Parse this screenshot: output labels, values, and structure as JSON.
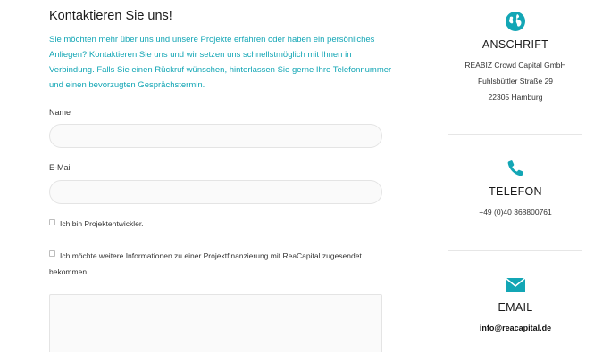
{
  "form": {
    "title": "Kontaktieren Sie uns!",
    "intro": "Sie möchten mehr über uns und unsere Projekte erfahren oder haben ein persönliches Anliegen? Kontaktieren Sie uns und wir setzen uns schnellstmöglich mit Ihnen in Verbindung. Falls Sie einen Rückruf wünschen, hinterlassen Sie gerne Ihre Telefonnummer und einen bevorzugten Gesprächstermin.",
    "name_label": "Name",
    "name_value": "",
    "email_label": "E-Mail",
    "email_value": "",
    "checkbox_developer": "Ich bin Projektentwickler.",
    "checkbox_info": "Ich möchte weitere Informationen zu einer Projektfinanzierung mit ReaCapital zugesendet bekommen.",
    "message_value": ""
  },
  "sidebar": {
    "address": {
      "icon": "globe-icon",
      "heading": "ANSCHRIFT",
      "line1": "REABIZ Crowd Capital GmbH",
      "line2": "Fuhlsbüttler Straße 29",
      "line3": "22305 Hamburg"
    },
    "phone": {
      "icon": "phone-icon",
      "heading": "TELEFON",
      "number": "+49 (0)40 368800761"
    },
    "email": {
      "icon": "envelope-icon",
      "heading": "EMAIL",
      "address": "info@reacapital.de"
    }
  },
  "colors": {
    "accent": "#13a6b5",
    "text": "#333333",
    "border": "#e4e4e4"
  }
}
